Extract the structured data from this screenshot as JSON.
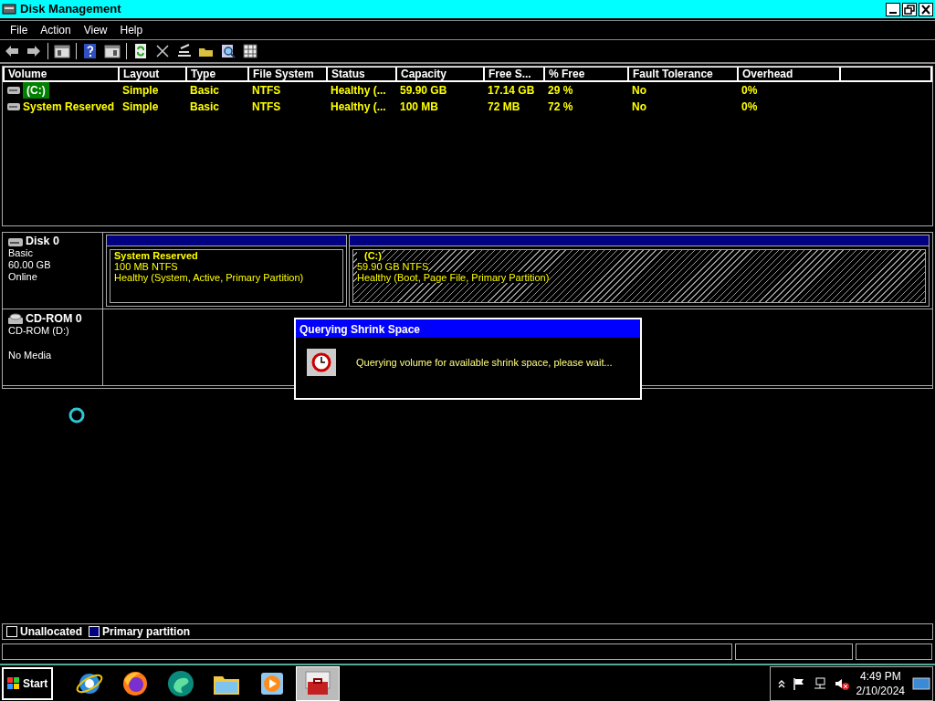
{
  "window": {
    "title": "Disk Management"
  },
  "menu": [
    "File",
    "Action",
    "View",
    "Help"
  ],
  "volume_table": {
    "columns": [
      "Volume",
      "Layout",
      "Type",
      "File System",
      "Status",
      "Capacity",
      "Free S...",
      "% Free",
      "Fault Tolerance",
      "Overhead"
    ],
    "rows": [
      {
        "selected": true,
        "cells": [
          "(C:)",
          "Simple",
          "Basic",
          "NTFS",
          "Healthy (...",
          "59.90 GB",
          "17.14 GB",
          "29 %",
          "No",
          "0%"
        ]
      },
      {
        "selected": false,
        "cells": [
          "System Reserved",
          "Simple",
          "Basic",
          "NTFS",
          "Healthy (...",
          "100 MB",
          "72 MB",
          "72 %",
          "No",
          "0%"
        ]
      }
    ]
  },
  "disks": [
    {
      "kind": "disk",
      "name": "Disk 0",
      "lines": [
        "Basic",
        "60.00 GB",
        "Online"
      ],
      "partitions": [
        {
          "name": "System Reserved",
          "size": "100 MB NTFS",
          "health": "Healthy (System, Active, Primary Partition)",
          "selected": false
        },
        {
          "name": "(C:)",
          "size": "59.90 GB NTFS",
          "health": "Healthy (Boot, Page File, Primary Partition)",
          "selected": true
        }
      ]
    },
    {
      "kind": "cdrom",
      "name": "CD-ROM 0",
      "lines": [
        "CD-ROM (D:)",
        "No Media"
      ]
    }
  ],
  "dialog": {
    "title": "Querying Shrink Space",
    "message": "Querying volume for available shrink space, please wait..."
  },
  "legend": [
    {
      "label": "Unallocated",
      "color": "#000000"
    },
    {
      "label": "Primary partition",
      "color": "#000080"
    }
  ],
  "taskbar": {
    "start": "Start",
    "apps": [
      {
        "kind": "ie",
        "selected": false
      },
      {
        "kind": "firefox",
        "selected": false
      },
      {
        "kind": "edge",
        "selected": false
      },
      {
        "kind": "explorer",
        "selected": false
      },
      {
        "kind": "media",
        "selected": false
      },
      {
        "kind": "toolbox",
        "selected": true
      }
    ],
    "time": "4:49 PM",
    "date": "2/10/2024"
  }
}
